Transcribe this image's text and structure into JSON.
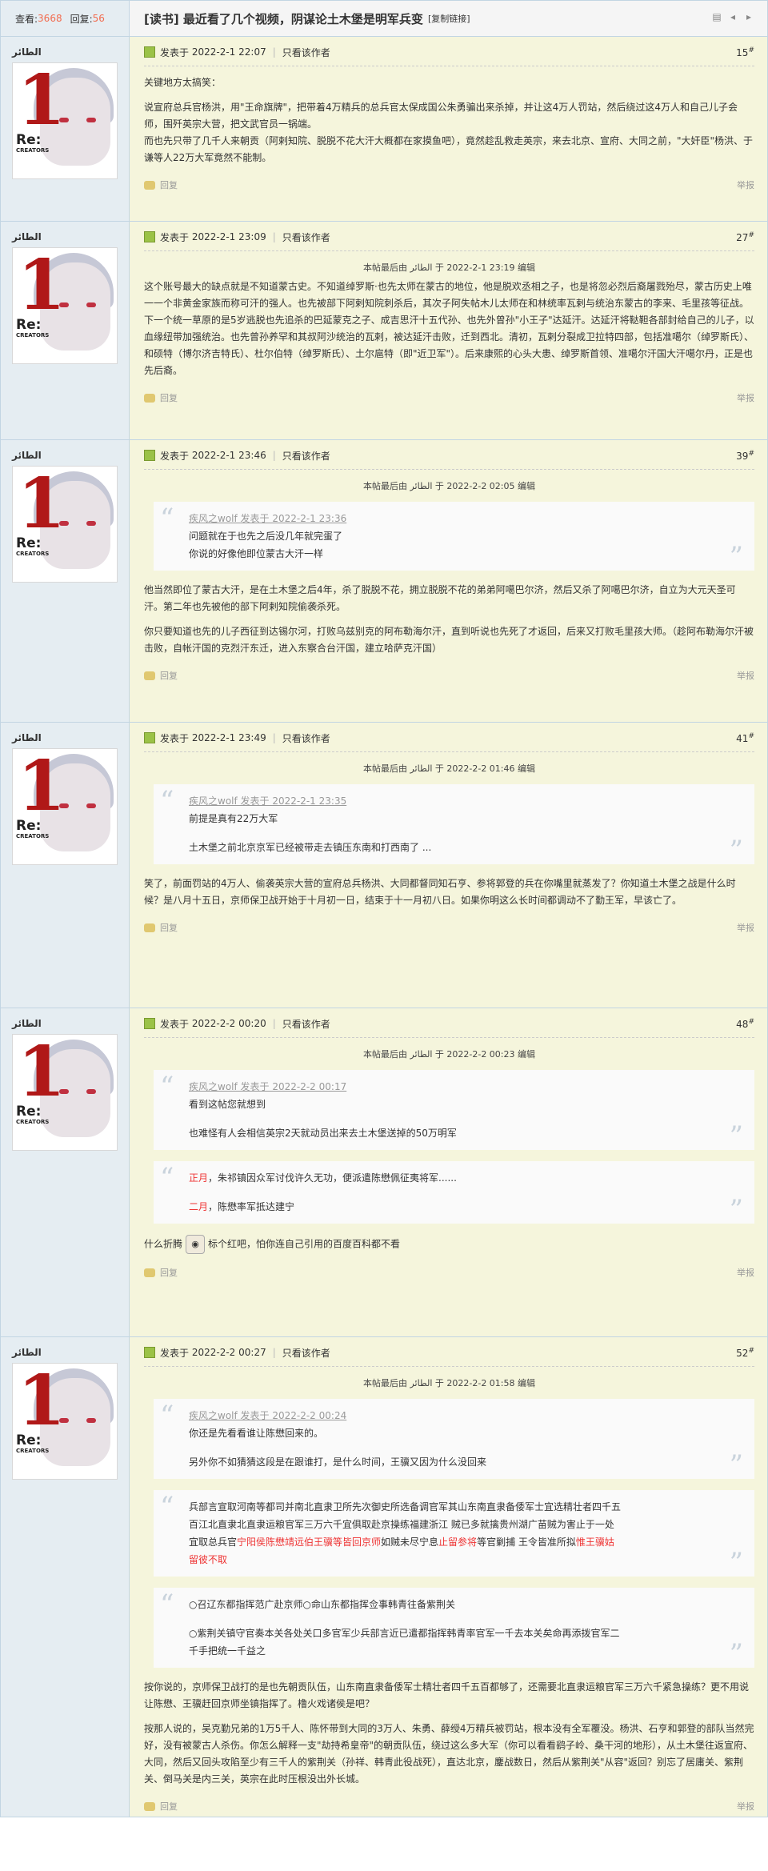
{
  "header": {
    "views_label": "查看:",
    "views": "3668",
    "replies_label": "回复:",
    "replies": "56",
    "title": "[读书] 最近看了几个视频，阴谋论土木堡是明军兵变",
    "copy_link": "[复制链接]"
  },
  "common": {
    "posted_prefix": "发表于",
    "only_author": "只看该作者",
    "reply": "回复",
    "report": "举报",
    "username": "الطائر",
    "avatar_re": "Re:",
    "avatar_creators": "CREATORS",
    "avatar_one": "1"
  },
  "posts": [
    {
      "time": "2022-2-1 22:07",
      "floor": "15",
      "edited": "",
      "paragraphs": [
        "关键地方太搞笑：",
        "说宣府总兵官杨洪，用\"王命旗牌\"，把带着4万精兵的总兵官太保成国公朱勇骗出来杀掉，并让这4万人罚站，然后绕过这4万人和自己儿子会师，围歼英宗大营，把文武官员一锅端。",
        "而也先只带了几千人来朝贡（阿剌知院、脱脱不花大汗大概都在家摸鱼吧），竟然趁乱救走英宗，来去北京、宣府、大同之前，\"大奸臣\"杨洪、于谦等人22万大军竟然不能制。"
      ]
    },
    {
      "time": "2022-2-1 23:09",
      "floor": "27",
      "edited": "本帖最后由 الطائر 于 2022-2-1 23:19 编辑",
      "paragraphs": [
        "这个账号最大的缺点就是不知道蒙古史。不知道绰罗斯·也先太师在蒙古的地位，他是脱欢丞相之子，也是将忽必烈后裔屠戮殆尽，蒙古历史上唯一一个非黄金家族而称可汗的强人。也先被部下阿剌知院刺杀后，其次子阿失帖木儿太师在和林统率瓦剌与统治东蒙古的李来、毛里孩等征战。下一个统一草原的是5岁逃脱也先追杀的巴延蒙克之子、成吉思汗十五代孙、也先外曾孙\"小王子\"达延汗。达延汗将鞑靼各部封给自己的儿子，以血缘纽带加强统治。也先曾孙养罕和其叔阿沙统治的瓦剌，被达延汗击败，迁到西北。清初，瓦剌分裂成卫拉特四部，包括准噶尔（绰罗斯氏）、和硕特（博尔济吉特氏）、杜尔伯特（绰罗斯氏）、土尔扈特（即\"近卫军\"）。后来康熙的心头大患、绰罗斯首领、准噶尔汗国大汗噶尔丹，正是也先后裔。"
      ]
    },
    {
      "time": "2022-2-1 23:46",
      "floor": "39",
      "edited": "本帖最后由 الطائر 于 2022-2-2 02:05 编辑",
      "quotes": [
        {
          "author": "疾风之wolf 发表于 2022-2-1 23:36",
          "lines": [
            "问题就在于也先之后没几年就完蛋了",
            "你说的好像他即位蒙古大汗一样"
          ]
        }
      ],
      "paragraphs": [
        "他当然即位了蒙古大汗，是在土木堡之后4年，杀了脱脱不花，拥立脱脱不花的弟弟阿噶巴尔济，然后又杀了阿噶巴尔济，自立为大元天圣可汗。第二年也先被他的部下阿剌知院偷袭杀死。",
        "你只要知道也先的儿子西征到达锡尔河，打败乌兹别克的阿布勒海尔汗，直到听说也先死了才返回，后来又打败毛里孩大师。（趁阿布勒海尔汗被击败，自帐汗国的克烈汗东迁，进入东察合台汗国，建立哈萨克汗国）"
      ]
    },
    {
      "time": "2022-2-1 23:49",
      "floor": "41",
      "edited": "本帖最后由 الطائر 于 2022-2-2 01:46 编辑",
      "quotes": [
        {
          "author": "疾风之wolf 发表于 2022-2-1 23:35",
          "lines": [
            "前提是真有22万大军",
            "",
            "土木堡之前北京京军已经被带走去镇压东南和打西南了 ..."
          ]
        }
      ],
      "paragraphs": [
        "笑了，前面罚站的4万人、偷袭英宗大营的宣府总兵杨洪、大同都督同知石亨、参将郭登的兵在你嘴里就蒸发了？你知道土木堡之战是什么时候？是八月十五日，京师保卫战开始于十月初一日，结束于十一月初八日。如果你明这么长时间都调动不了勤王军，早该亡了。"
      ]
    },
    {
      "time": "2022-2-2 00:20",
      "floor": "48",
      "edited": "本帖最后由 الطائر 于 2022-2-2 00:23 编辑",
      "quotes": [
        {
          "author": "疾风之wolf 发表于 2022-2-2 00:17",
          "lines": [
            "看到这帖您就想到",
            "",
            "也难怪有人会相信英宗2天就动员出来去土木堡送掉的50万明军"
          ]
        },
        {
          "author": "",
          "lines": [
            "正月，朱祁镇因众军讨伐许久无功，便派遣陈懋佩征夷将军......",
            "",
            "二月，陈懋率军抵达建宁"
          ],
          "red_prefixes": [
            "正月",
            "",
            "二月"
          ]
        }
      ],
      "paragraphs": [
        "什么折腾 [表情] 标个红吧，怕你连自己引用的百度百科都不看"
      ],
      "emoji_text_before": "什么折腾",
      "emoji_text_after": "标个红吧，怕你连自己引用的百度百科都不看"
    },
    {
      "time": "2022-2-2 00:27",
      "floor": "52",
      "edited": "本帖最后由 الطائر 于 2022-2-2 01:58 编辑",
      "quotes": [
        {
          "author": "疾风之wolf 发表于 2022-2-2 00:24",
          "lines": [
            "你还是先看看谁让陈懋回来的。",
            "",
            "另外你不如猜猜这段是在跟谁打，是什么时间，王骥又因为什么没回来"
          ]
        },
        {
          "author": "",
          "lines": [
            "兵部言宣取河南等都司并南北直隶卫所先次御史所选备调官军其山东南直隶备倭军士宜选精壮者四千五",
            "百江北直隶北直隶运粮官军三万六千宜俱取赴京操练福建浙江 贼已多就擒贵州湖广苗贼为害止于一处",
            "宜取总兵官宁阳侯陈懋靖远伯王骥等皆回京师如贼未尽宁息止留参将等官剿捕 王令皆准所拟惟王骥姑",
            "留彼不取"
          ]
        },
        {
          "author": "",
          "lines": [
            "○召辽东都指挥范广赴京师○命山东都指挥佥事韩青往备紫荆关",
            "",
            "○紫荆关镇守官奏本关各处关口多官军少兵部言近已遣都指挥韩青率官军一千去本关矣命再添拨官军二",
            "千手把统一千益之"
          ]
        }
      ],
      "paragraphs": [
        "按你说的，京师保卫战打的是也先朝贡队伍，山东南直隶备倭军士精壮者四千五百都够了，还需要北直隶运粮官军三万六千紧急操练？更不用说让陈懋、王骥赶回京师坐镇指挥了。橹火戏诸侯是吧？",
        "按那人说的，吴克勤兄弟的1万5千人、陈怀带到大同的3万人、朱勇、薛绶4万精兵被罚站，根本没有全军覆没。杨洪、石亨和郭登的部队当然完好，没有被蒙古人杀伤。你怎么解释一支\"劫持希皇帝\"的朝贡队伍，绕过这么多大军（你可以看看鹞子岭、桑干河的地形），从土木堡往返宣府、大同，然后又回头攻陷至少有三千人的紫荆关（孙祥、韩青此役战死），直达北京，鏖战数日，然后从紫荆关\"从容\"返回？别忘了居庸关、紫荆关、倒马关是内三关，英宗在此时压根没出外长城。"
      ]
    }
  ],
  "post52_quote2_red": [
    "宁阳侯陈懋靖远伯王骥等皆回京师",
    "止留参将",
    "惟王骥姑",
    "留彼不取"
  ],
  "emoji_label": "表情"
}
